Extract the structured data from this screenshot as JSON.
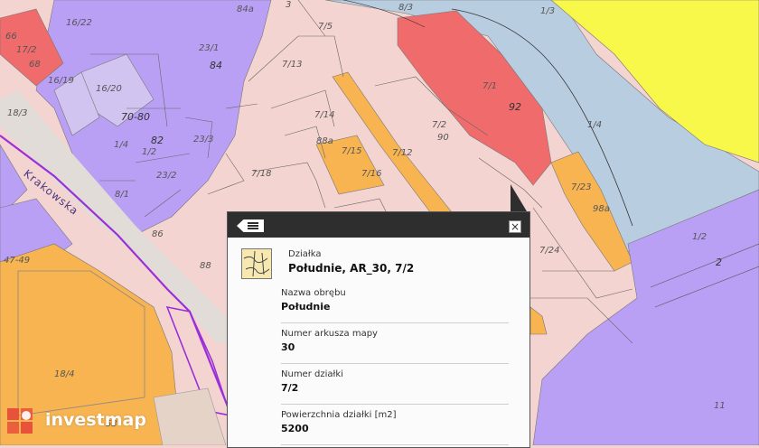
{
  "map": {
    "street_name": "Krakowska",
    "parcel_labels": [
      "66",
      "17/2",
      "68",
      "16/22",
      "84a",
      "3",
      "8/3",
      "1/3",
      "7/5",
      "23/1",
      "84",
      "16/19",
      "16/20",
      "7/13",
      "7/1",
      "92",
      "18/3",
      "70-80",
      "7/14",
      "7/2",
      "90",
      "1/4",
      "1/4",
      "82",
      "23/3",
      "1/2",
      "88a",
      "7/15",
      "7/12",
      "7/16",
      "23/2",
      "8/1",
      "7/18",
      "7/23",
      "98a",
      "86",
      "7/24",
      "47-49",
      "1/2",
      "2",
      "88",
      "18/4",
      "53",
      "11"
    ],
    "address_labels": [
      "84",
      "92",
      "70-80",
      "90",
      "82",
      "88a",
      "86",
      "98a",
      "88",
      "53",
      "2"
    ],
    "colors": {
      "residential": "#f4d4d0",
      "lilac": "#b9a0f5",
      "orange": "#f8b450",
      "red": "#f06b6b",
      "lightblue": "#b9cde0",
      "yellow": "#f8f84a",
      "road": "#e9d8d4",
      "street_line": "#9b30d9"
    }
  },
  "popup": {
    "layer_type": "Działka",
    "layer_title": "Południe, AR_30, 7/2",
    "fields": [
      {
        "label": "Nazwa obrębu",
        "value": "Południe"
      },
      {
        "label": "Numer arkusza mapy",
        "value": "30"
      },
      {
        "label": "Numer działki",
        "value": "7/2"
      },
      {
        "label": "Powierzchnia działki [m2]",
        "value": "5200"
      }
    ],
    "close_symbol": "×",
    "icons": {
      "list": "list-icon",
      "close": "close-icon",
      "layer": "parcel-layer-icon"
    }
  },
  "branding": {
    "logo_text": "investmap",
    "logo_color": "#e8513a"
  }
}
